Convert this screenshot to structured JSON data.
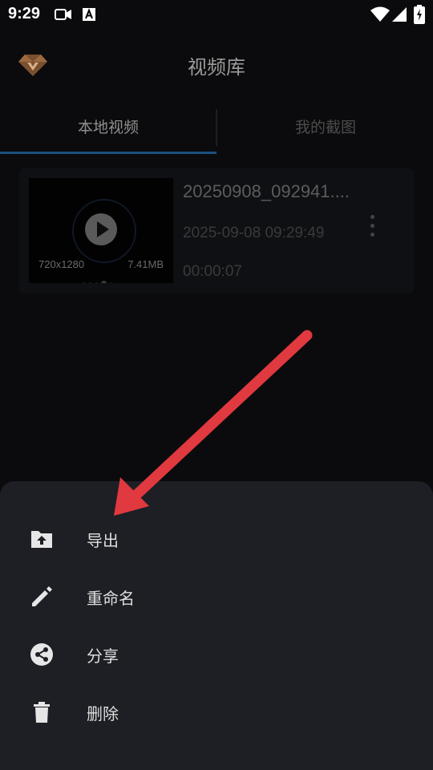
{
  "status_bar": {
    "time": "9:29",
    "icons": [
      "video-camera-icon",
      "text-a-icon",
      "wifi-icon",
      "signal-icon",
      "battery-charging-icon"
    ]
  },
  "header": {
    "logo": "diamond-logo-icon",
    "title": "视频库"
  },
  "tabs": [
    {
      "label": "本地视频",
      "active": true
    },
    {
      "label": "我的截图",
      "active": false
    }
  ],
  "video": {
    "filename": "20250908_092941....",
    "datetime": "2025-09-08 09:29:49",
    "duration": "00:00:07",
    "resolution": "720x1280",
    "size": "7.41MB"
  },
  "menu": {
    "items": [
      {
        "label": "导出",
        "icon": "folder-upload-icon"
      },
      {
        "label": "重命名",
        "icon": "pencil-icon"
      },
      {
        "label": "分享",
        "icon": "share-icon"
      },
      {
        "label": "删除",
        "icon": "trash-icon"
      }
    ]
  },
  "colors": {
    "background": "#0b0b0d",
    "sheet": "#1d1f24",
    "tab_indicator": "#1c4e7e",
    "annotation_arrow": "#e0393f"
  }
}
